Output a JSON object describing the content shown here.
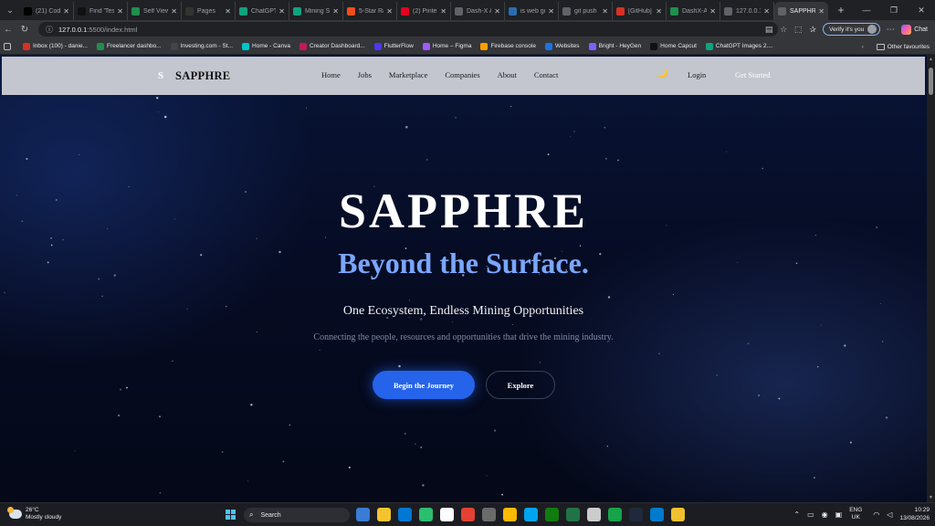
{
  "browser": {
    "tabs": [
      {
        "label": "(21) Code",
        "icon": "x-icon",
        "color": "#000000"
      },
      {
        "label": "Find 'Test",
        "icon": "tiktok-icon",
        "color": "#111111"
      },
      {
        "label": "Self View",
        "icon": "green-app-icon",
        "color": "#1f8f4e"
      },
      {
        "label": "Pages",
        "icon": "github-icon",
        "color": "#333333"
      },
      {
        "label": "ChatGPT",
        "icon": "chatgpt-icon",
        "color": "#10a37f"
      },
      {
        "label": "Mining Sa",
        "icon": "chatgpt-icon",
        "color": "#10a37f"
      },
      {
        "label": "5-Star Ra",
        "icon": "figma-icon",
        "color": "#f24e1e"
      },
      {
        "label": "(2) Pintere",
        "icon": "pinterest-icon",
        "color": "#e60023"
      },
      {
        "label": "Dash-X Ar",
        "icon": "globe-icon",
        "color": "#5f6368"
      },
      {
        "label": "is web go",
        "icon": "bing-icon",
        "color": "#2b6cb0"
      },
      {
        "label": "git push",
        "icon": "globe-icon",
        "color": "#5f6368"
      },
      {
        "label": "[GitHub] S",
        "icon": "gmail-icon",
        "color": "#d93025"
      },
      {
        "label": "DashX-Ap",
        "icon": "green-app-icon",
        "color": "#1f8f4e"
      },
      {
        "label": "127.0.0.1",
        "icon": "globe-icon",
        "color": "#5f6368"
      },
      {
        "label": "SAPPHRE",
        "icon": "globe-icon",
        "color": "#5f6368",
        "active": true
      }
    ],
    "url_host": "127.0.0.1",
    "url_path": ":5500/index.html",
    "verify_label": "Verify it's you",
    "chat_label": "Chat",
    "bookmarks": [
      {
        "label": "Inbox (100) - danie...",
        "color": "#d93025"
      },
      {
        "label": "Freelancer dashbo...",
        "color": "#1f8f4e"
      },
      {
        "label": "Investing.com - St...",
        "color": "#444444"
      },
      {
        "label": "Home - Canva",
        "color": "#00c4cc"
      },
      {
        "label": "Creator Dashboard...",
        "color": "#c2185b"
      },
      {
        "label": "FlutterFlow",
        "color": "#4b39ef"
      },
      {
        "label": "Home – Figma",
        "color": "#a259ff"
      },
      {
        "label": "Firebase console",
        "color": "#ffa000"
      },
      {
        "label": "Websites",
        "color": "#1a73e8"
      },
      {
        "label": "Bright - HeyGen",
        "color": "#7b61ff"
      },
      {
        "label": "Home Capcut",
        "color": "#111111"
      },
      {
        "label": "ChatGPT Images 2....",
        "color": "#10a37f"
      }
    ],
    "other_bookmarks": "Other favourites"
  },
  "site": {
    "brand": "SAPPHRE",
    "brand_mark": "S",
    "nav": [
      "Home",
      "Jobs",
      "Marketplace",
      "Companies",
      "About",
      "Contact"
    ],
    "theme_toggle_glyph": "🌙",
    "login": "Login",
    "get_started": "Get Started",
    "hero": {
      "title": "SAPPHRE",
      "subtitle": "Beyond the Surface.",
      "tagline": "One Ecosystem, Endless Mining Opportunities",
      "description": "Connecting the people, resources and opportunities that drive the mining industry.",
      "primary_cta": "Begin the Journey",
      "secondary_cta": "Explore"
    },
    "colors": {
      "accent": "#2563eb",
      "subtitle": "#7aa6ff",
      "background": "#060c24"
    }
  },
  "taskbar": {
    "weather_temp": "26°C",
    "weather_desc": "Mostly cloudy",
    "search_placeholder": "Search",
    "lang_line1": "ENG",
    "lang_line2": "UK",
    "time": "10:29",
    "date": "13/08/2026",
    "apps": [
      "#3a7bd5",
      "#f4c430",
      "#0078d4",
      "#2dbd6e",
      "#ffffff",
      "#e34133",
      "#6b6b6b",
      "#ffb900",
      "#00a4ef",
      "#107c10",
      "#217346",
      "#cccccc",
      "#16a34a",
      "#1e293b",
      "#007acc",
      "#f0c030"
    ]
  }
}
